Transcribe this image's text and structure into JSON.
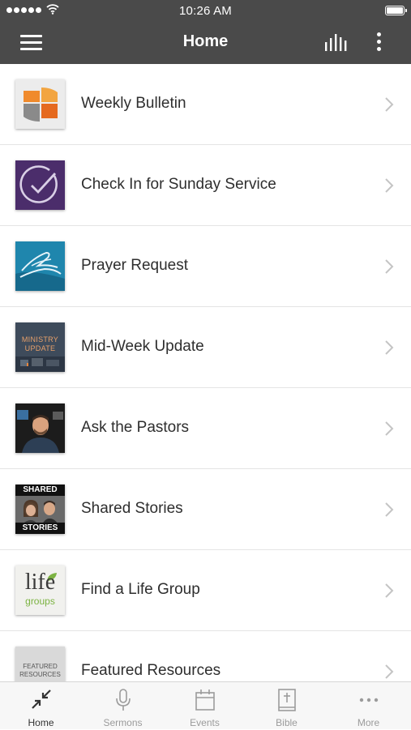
{
  "status_bar": {
    "time": "10:26 AM"
  },
  "header": {
    "title": "Home"
  },
  "thumbnails": {
    "mid_week_update_text": [
      "MINISTRY",
      "UPDATE"
    ],
    "shared_stories_text": [
      "SHARED",
      "STORIES"
    ],
    "life_group_text": [
      "life",
      "groups"
    ],
    "featured_resources_text": [
      "FEATURED",
      "RESOURCES"
    ]
  },
  "items": [
    {
      "label": "Weekly Bulletin"
    },
    {
      "label": "Check In for Sunday Service"
    },
    {
      "label": "Prayer Request"
    },
    {
      "label": "Mid-Week Update"
    },
    {
      "label": "Ask the Pastors"
    },
    {
      "label": "Shared Stories"
    },
    {
      "label": "Find a Life Group"
    },
    {
      "label": "Featured Resources"
    }
  ],
  "tabs": [
    {
      "label": "Home",
      "icon": "collapse-arrows-icon",
      "active": true
    },
    {
      "label": "Sermons",
      "icon": "microphone-icon",
      "active": false
    },
    {
      "label": "Events",
      "icon": "calendar-icon",
      "active": false
    },
    {
      "label": "Bible",
      "icon": "bible-icon",
      "active": false
    },
    {
      "label": "More",
      "icon": "more-dots-icon",
      "active": false
    }
  ],
  "colors": {
    "header_bg": "#4a4a4a",
    "tab_active": "#333333",
    "tab_inactive": "#9b9b9b",
    "check_in_purple": "#4b2d6b",
    "prayer_blue": "#1f86ad"
  }
}
